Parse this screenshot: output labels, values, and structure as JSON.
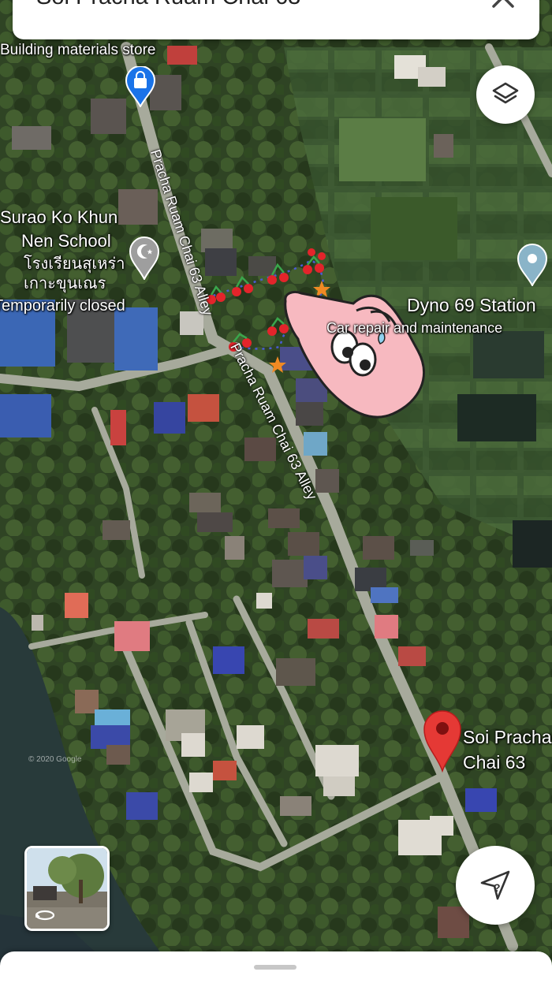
{
  "search": {
    "query": "Soi Pracha Ruam Chai 63"
  },
  "labels": {
    "building_store": "Building materials store",
    "school_line1": "Surao Ko Khun",
    "school_line2": "Nen School",
    "school_thai": "โรงเรียนสุเหร่าเกาะขุนเณร",
    "school_status": "Temporarily closed",
    "station_name": "Dyno 69 Station",
    "station_category": "Car repair and maintenance",
    "road_upper": "Pracha Ruam Chai 63 Alley",
    "road_lower": "Pracha Ruam Chai 63 Alley",
    "place_line1": "Soi Pracha",
    "place_line2": "Chai 63",
    "copyright": "© 2020 Google"
  },
  "icons": {
    "close": "close-icon",
    "layers": "layers-icon",
    "directions": "directions-icon",
    "store_pin": "shopping-bag-pin-icon",
    "school_pin": "mosque-crescent-pin-icon",
    "generic_pin": "place-pin-icon",
    "selected_pin": "red-location-pin-icon",
    "rotate": "rotate-360-icon"
  },
  "colors": {
    "selected_pin": "#e53935",
    "store_pin": "#1a73e8",
    "school_pin": "#9e9e9e",
    "generic_pin": "#8ab4c8",
    "sticker_hand": "#f7b9c0"
  }
}
